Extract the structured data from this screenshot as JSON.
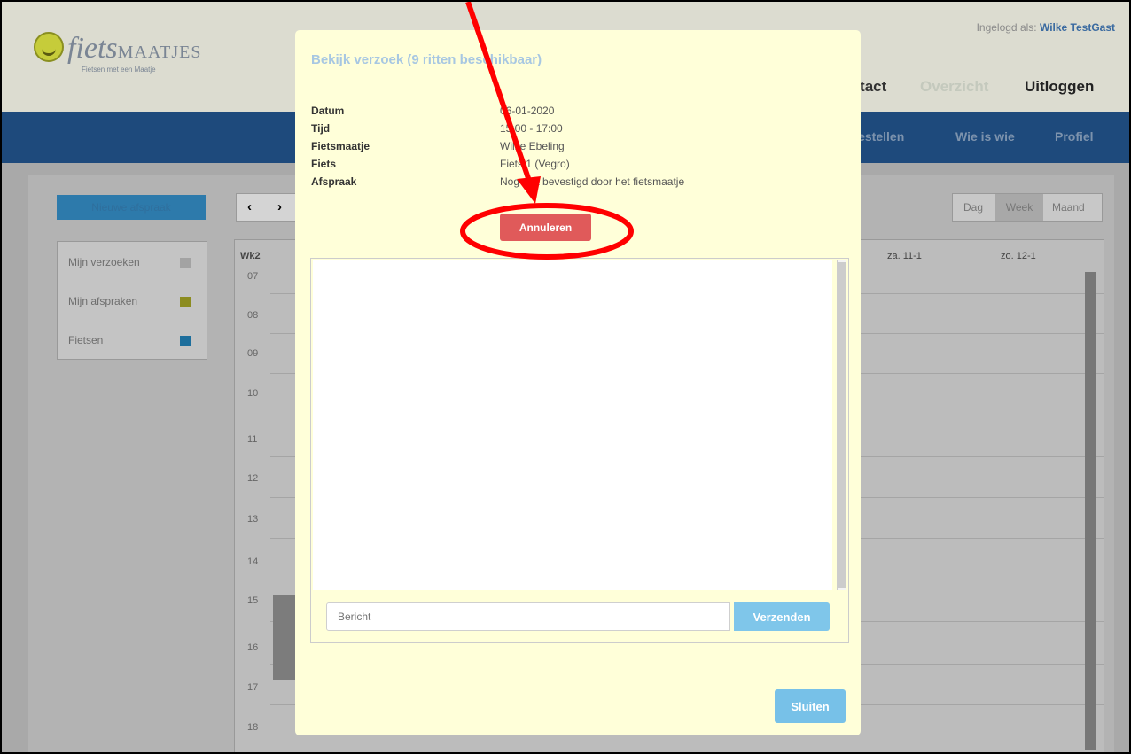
{
  "header": {
    "login_label": "Ingelogd als:",
    "login_user": "Wilke TestGast",
    "nav": [
      "Contact",
      "Overzicht",
      "Uitloggen"
    ]
  },
  "logo": {
    "text_italic": "fiets",
    "text_caps": "MAATJES",
    "tagline": "Fietsen met een Maatje"
  },
  "navbar": {
    "items": [
      "Bestellen",
      "Wie is wie",
      "Profiel"
    ]
  },
  "calendar": {
    "new_button": "Nieuwe afspraak",
    "prev": "‹",
    "next": "›",
    "legend": [
      {
        "label": "Mijn verzoeken",
        "color": "#a3a3a3"
      },
      {
        "label": "Mijn afspraken",
        "color": "#8c8c20"
      },
      {
        "label": "Fietsen",
        "color": "#1d6e9c"
      }
    ],
    "views": [
      "Dag",
      "Week",
      "Maand"
    ],
    "week_label": "Wk2",
    "columns": [
      "za. 11-1",
      "zo. 12-1"
    ],
    "hours": [
      "07",
      "08",
      "09",
      "10",
      "11",
      "12",
      "13",
      "14",
      "15",
      "16",
      "17",
      "18"
    ]
  },
  "modal": {
    "title": "Bekijk verzoek (9 ritten beschikbaar)",
    "fields": [
      {
        "label": "Datum",
        "value": "06-01-2020"
      },
      {
        "label": "Tijd",
        "value": "15:00 - 17:00"
      },
      {
        "label": "Fietsmaatje",
        "value": "Wilke Ebeling"
      },
      {
        "label": "Fiets",
        "value": "Fiets 1 (Vegro)"
      },
      {
        "label": "Afspraak",
        "value": "Nog niet bevestigd door het fietsmaatje"
      }
    ],
    "cancel_label": "Annuleren",
    "message_placeholder": "Bericht",
    "send_label": "Verzenden",
    "close_label": "Sluiten"
  },
  "colors": {
    "annotation": "#ff0000",
    "cancel": "#e05a5a",
    "primary": "#7fc6ea",
    "modal_bg": "#ffffd9"
  }
}
